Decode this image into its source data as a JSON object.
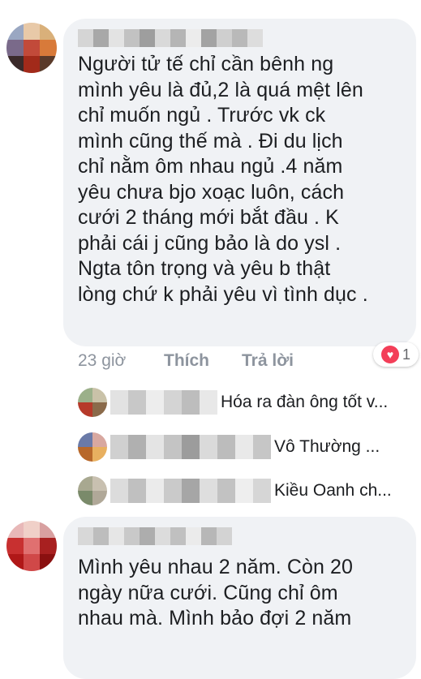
{
  "comments": [
    {
      "text": "Người tử tế chỉ cần bênh ng\nmình yêu là đủ,2 là quá mệt lên\nchỉ muốn ngủ . Trước vk ck\nmình cũng thế mà . Đi du lịch\nchỉ nằm ôm nhau ngủ .4 năm\nyêu chưa bjo xoạc luôn, cách\ncưới 2 tháng mới bắt đầu . K\nphải cái j cũng bảo là do ysl .\nNgta tôn trọng và yêu b thật\nlòng chứ k phải yêu vì tình dục .",
      "time": "23 giờ",
      "like_label": "Thích",
      "reply_label": "Trả lời",
      "reaction_count": "1"
    },
    {
      "text": "Mình yêu nhau 2 năm. Còn 20\nngày nữa cưới. Cũng chỉ ôm\nnhau mà. Mình bảo đợi 2 năm"
    }
  ],
  "replies": [
    {
      "preview": "Hóa ra đàn ông tốt v..."
    },
    {
      "preview": "Vô Thường ..."
    },
    {
      "preview": "Kiều Oanh ch..."
    }
  ],
  "colors": {
    "bubble": "#f0f2f5",
    "text": "#1c1e21",
    "meta": "#8d949e",
    "reaction": "#f33e58"
  }
}
